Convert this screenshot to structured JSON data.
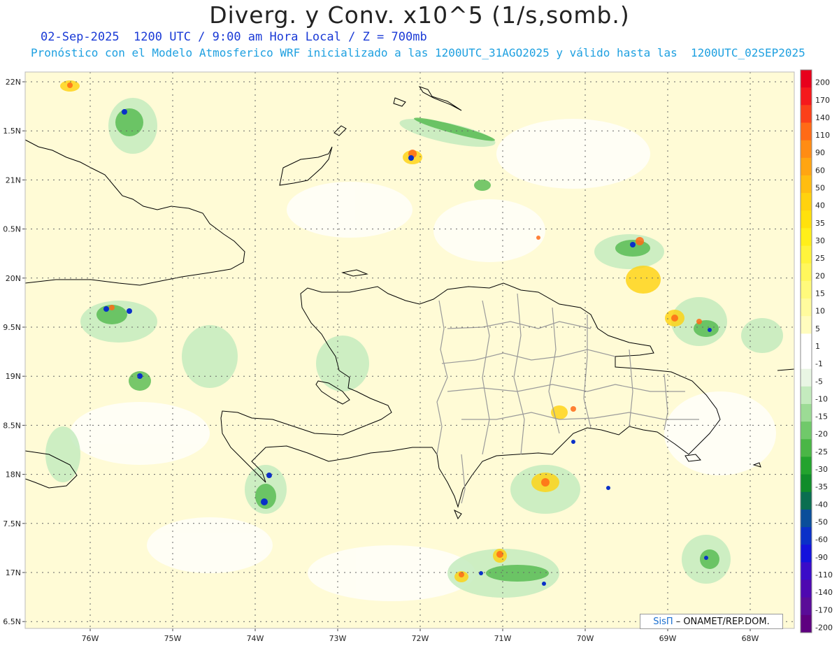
{
  "header": {
    "title": "Diverg. y Conv. x10^5 (1/s,somb.)",
    "subtitle_time": "02-Sep-2025  1200 UTC / 9:00 am Hora Local / Z = 700mb",
    "subtitle_model": "Pronóstico con el Modelo Atmosferico WRF inicializado a las 1200UTC_31AGO2025 y válido hasta las  1200UTC_02SEP2025"
  },
  "map": {
    "lon_range": [
      -76.6,
      -67.6
    ],
    "lat_range": [
      16.4,
      22.1
    ],
    "lat_labels": [
      "22N",
      "1.5N",
      "21N",
      "0.5N",
      "20N",
      "9.5N",
      "19N",
      "8.5N",
      "18N",
      "7.5N",
      "17N",
      "6.5N"
    ],
    "lon_labels": [
      "76W",
      "75W",
      "74W",
      "73W",
      "72W",
      "71W",
      "70W",
      "69W",
      "68W"
    ],
    "background_color": "#fffbd6",
    "coastline_color": "#000000",
    "province_color": "#9a9a9a"
  },
  "colorbar": {
    "labels": [
      "200",
      "170",
      "140",
      "110",
      "90",
      "60",
      "50",
      "40",
      "35",
      "30",
      "25",
      "20",
      "15",
      "10",
      "5",
      "1",
      "-1",
      "-5",
      "-10",
      "-15",
      "-20",
      "-25",
      "-30",
      "-35",
      "-40",
      "-50",
      "-60",
      "-90",
      "-110",
      "-140",
      "-170",
      "-200"
    ],
    "colors": [
      "#e8001c",
      "#f5191c",
      "#fb4019",
      "#ff6a16",
      "#ff8c14",
      "#ffa512",
      "#ffbd10",
      "#ffd20e",
      "#ffe10c",
      "#ffef1a",
      "#fff43c",
      "#fff75c",
      "#fffa7c",
      "#fffb9e",
      "#fffcbe",
      "#ffffff",
      "#ffffff",
      "#e9f6e4",
      "#c4ebbe",
      "#9cdb95",
      "#70c96a",
      "#4ab646",
      "#23a32e",
      "#108c2a",
      "#0a6e50",
      "#0a4e9a",
      "#0a30c8",
      "#1412dc",
      "#3a0cc8",
      "#4e08b0",
      "#5a0c98",
      "#5e0080"
    ]
  },
  "credit": {
    "brand": "SisΠ",
    "text": "– ONAMET/REP.DOM."
  }
}
